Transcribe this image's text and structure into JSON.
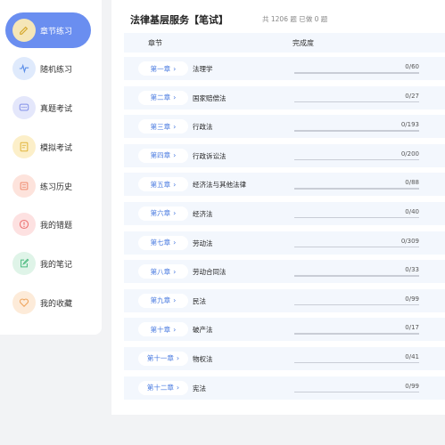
{
  "sidebar": {
    "items": [
      {
        "label": "章节练习",
        "icon": "edit-icon",
        "active": true,
        "icon_bg": "#f5e6b8",
        "icon_color": "#d4a62a"
      },
      {
        "label": "随机练习",
        "icon": "pulse-icon",
        "active": false,
        "icon_bg": "#dfeafc",
        "icon_color": "#5a8de8"
      },
      {
        "label": "真题考试",
        "icon": "chat-icon",
        "active": false,
        "icon_bg": "#e4e7fb",
        "icon_color": "#8290e8"
      },
      {
        "label": "模拟考试",
        "icon": "document-icon",
        "active": false,
        "icon_bg": "#fcefc9",
        "icon_color": "#e0b43a"
      },
      {
        "label": "练习历史",
        "icon": "history-icon",
        "active": false,
        "icon_bg": "#fde3dc",
        "icon_color": "#ee8a6e"
      },
      {
        "label": "我的错题",
        "icon": "alert-icon",
        "active": false,
        "icon_bg": "#fde1e1",
        "icon_color": "#ec6f6f"
      },
      {
        "label": "我的笔记",
        "icon": "note-icon",
        "active": false,
        "icon_bg": "#dff4e8",
        "icon_color": "#4cba7f"
      },
      {
        "label": "我的收藏",
        "icon": "heart-icon",
        "active": false,
        "icon_bg": "#fdebd9",
        "icon_color": "#eea25a"
      }
    ]
  },
  "main": {
    "title": "法律基层服务【笔试】",
    "summary": "共 1206 题 已做 0 题",
    "columns": {
      "chapter": "章节",
      "progress": "完成度"
    },
    "chapters": [
      {
        "label": "第一章",
        "name": "法理学",
        "done": 0,
        "total": 60,
        "progress_text": "0/60"
      },
      {
        "label": "第二章",
        "name": "国家赔偿法",
        "done": 0,
        "total": 27,
        "progress_text": "0/27"
      },
      {
        "label": "第三章",
        "name": "行政法",
        "done": 0,
        "total": 193,
        "progress_text": "0/193"
      },
      {
        "label": "第四章",
        "name": "行政诉讼法",
        "done": 0,
        "total": 200,
        "progress_text": "0/200"
      },
      {
        "label": "第五章",
        "name": "经济法与其他法律",
        "done": 0,
        "total": 88,
        "progress_text": "0/88"
      },
      {
        "label": "第六章",
        "name": "经济法",
        "done": 0,
        "total": 40,
        "progress_text": "0/40"
      },
      {
        "label": "第七章",
        "name": "劳动法",
        "done": 0,
        "total": 309,
        "progress_text": "0/309"
      },
      {
        "label": "第八章",
        "name": "劳动合同法",
        "done": 0,
        "total": 33,
        "progress_text": "0/33"
      },
      {
        "label": "第九章",
        "name": "民法",
        "done": 0,
        "total": 99,
        "progress_text": "0/99"
      },
      {
        "label": "第十章",
        "name": "破产法",
        "done": 0,
        "total": 17,
        "progress_text": "0/17"
      },
      {
        "label": "第十一章",
        "name": "物权法",
        "done": 0,
        "total": 41,
        "progress_text": "0/41"
      },
      {
        "label": "第十二章",
        "name": "宪法",
        "done": 0,
        "total": 99,
        "progress_text": "0/99"
      }
    ]
  },
  "colors": {
    "accent": "#6a8ef0",
    "link": "#4a7be0",
    "row_bg": "#f3f7fd"
  }
}
